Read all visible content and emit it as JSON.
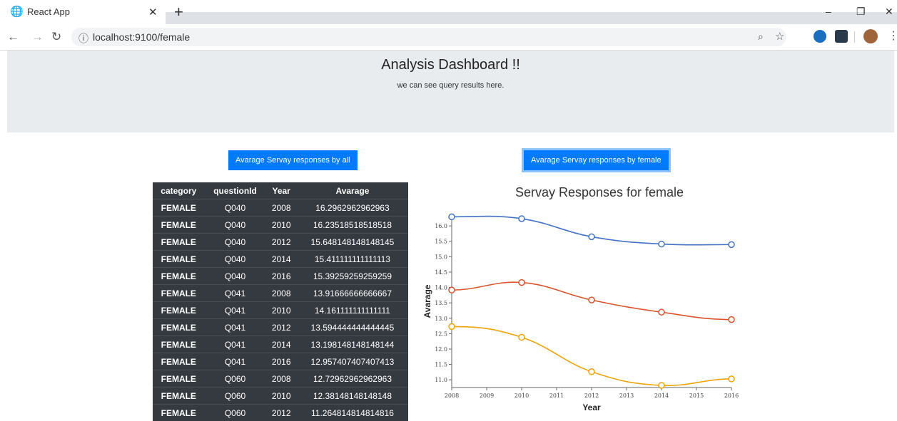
{
  "browser": {
    "tab_title": "React App",
    "url": "localhost:9100/female"
  },
  "page": {
    "title": "Analysis Dashboard !!",
    "subtitle": "we can see query results here.",
    "button_all": "Avarage Servay responses by all",
    "button_female": "Avarage Servay responses by female",
    "chart_title": "Servay Responses for female"
  },
  "table": {
    "headers": [
      "category",
      "questionId",
      "Year",
      "Avarage"
    ],
    "rows": [
      [
        "FEMALE",
        "Q040",
        "2008",
        "16.2962962962963"
      ],
      [
        "FEMALE",
        "Q040",
        "2010",
        "16.23518518518518"
      ],
      [
        "FEMALE",
        "Q040",
        "2012",
        "15.648148148148145"
      ],
      [
        "FEMALE",
        "Q040",
        "2014",
        "15.411111111111113"
      ],
      [
        "FEMALE",
        "Q040",
        "2016",
        "15.39259259259259"
      ],
      [
        "FEMALE",
        "Q041",
        "2008",
        "13.91666666666667"
      ],
      [
        "FEMALE",
        "Q041",
        "2010",
        "14.161111111111111"
      ],
      [
        "FEMALE",
        "Q041",
        "2012",
        "13.594444444444445"
      ],
      [
        "FEMALE",
        "Q041",
        "2014",
        "13.198148148148144"
      ],
      [
        "FEMALE",
        "Q041",
        "2016",
        "12.957407407407413"
      ],
      [
        "FEMALE",
        "Q060",
        "2008",
        "12.72962962962963"
      ],
      [
        "FEMALE",
        "Q060",
        "2010",
        "12.38148148148148"
      ],
      [
        "FEMALE",
        "Q060",
        "2012",
        "11.264814814814816"
      ]
    ]
  },
  "chart_data": {
    "type": "line",
    "title": "Servay Responses for female",
    "xlabel": "Year",
    "ylabel": "Avarage",
    "x": [
      2008,
      2010,
      2012,
      2014,
      2016
    ],
    "xticks": [
      2008,
      2009,
      2010,
      2011,
      2012,
      2013,
      2014,
      2015,
      2016
    ],
    "yticks": [
      11.0,
      11.5,
      12.0,
      12.5,
      13.0,
      13.5,
      14.0,
      14.5,
      15.0,
      15.5,
      16.0
    ],
    "ylim": [
      10.75,
      16.35
    ],
    "series": [
      {
        "color": "#4472c4",
        "values": [
          16.296,
          16.235,
          15.648,
          15.411,
          15.393
        ]
      },
      {
        "color": "#d9532c",
        "values": [
          13.917,
          14.161,
          13.594,
          13.198,
          12.957
        ]
      },
      {
        "color": "#f0a30a",
        "values": [
          12.73,
          12.381,
          11.265,
          10.82,
          11.03
        ]
      }
    ]
  }
}
